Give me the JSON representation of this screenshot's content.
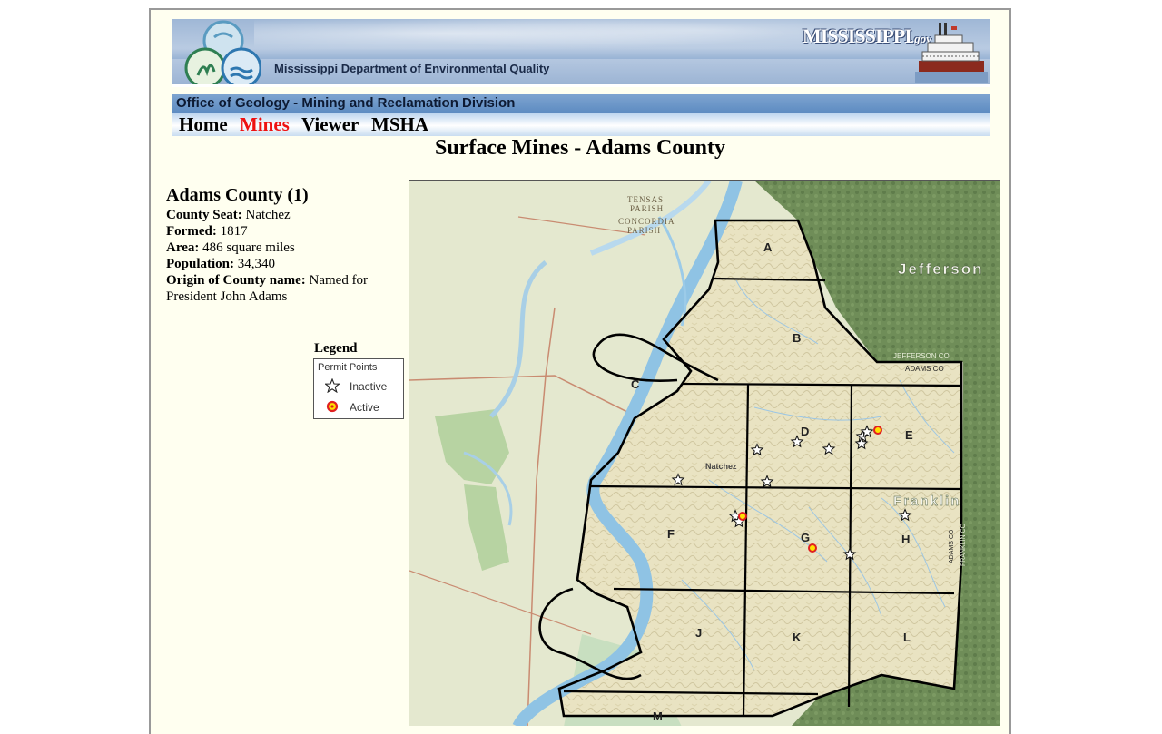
{
  "header": {
    "agency_name": "Mississippi Department of Environmental Quality",
    "ms_logo_text": "MISSISSIPPI",
    "ms_logo_suffix": ".gov"
  },
  "office_bar": {
    "label": "Office of Geology - Mining and Reclamation Division"
  },
  "nav": {
    "items": [
      {
        "label": "Home",
        "active": false
      },
      {
        "label": "Mines",
        "active": true
      },
      {
        "label": "Viewer",
        "active": false
      },
      {
        "label": "MSHA",
        "active": false
      }
    ],
    "active_color": "#ee1111"
  },
  "page_title": "Surface Mines - Adams County",
  "county": {
    "heading": "Adams County (1)",
    "fields": [
      {
        "label": "County Seat:",
        "value": "Natchez"
      },
      {
        "label": "Formed:",
        "value": "1817"
      },
      {
        "label": "Area:",
        "value": "486 square miles"
      },
      {
        "label": "Population:",
        "value": "34,340"
      },
      {
        "label": "Origin of County name:",
        "value": "Named for President John Adams"
      }
    ]
  },
  "legend": {
    "title": "Legend",
    "group": "Permit Points",
    "items": [
      {
        "label": "Inactive",
        "icon": "star-outline-icon"
      },
      {
        "label": "Active",
        "icon": "red-yellow-dot-icon"
      }
    ]
  },
  "map": {
    "grid_labels": [
      "A",
      "B",
      "C",
      "D",
      "E",
      "F",
      "G",
      "H",
      "J",
      "K",
      "L",
      "M"
    ],
    "place_labels": {
      "jefferson": "Jefferson",
      "franklin": "Franklin",
      "natchez": "Natchez",
      "tensas_parish_1": "TENSAS",
      "tensas_parish_2": "PARISH",
      "concordia_parish_1": "CONCORDIA",
      "concordia_parish_2": "PARISH",
      "jefferson_co": "JEFFERSON CO",
      "adams_co_top": "ADAMS CO",
      "adams_co_side": "ADAMS CO",
      "franklin_co": "FRANKLIN CO"
    },
    "colors": {
      "river": "#8fc3e4",
      "county_relief": "#e9e3c2",
      "neighbor_forest": "#6d8c56",
      "boundary": "#000000",
      "active_fill": "#ffe000",
      "active_dot": "#e02020"
    }
  }
}
